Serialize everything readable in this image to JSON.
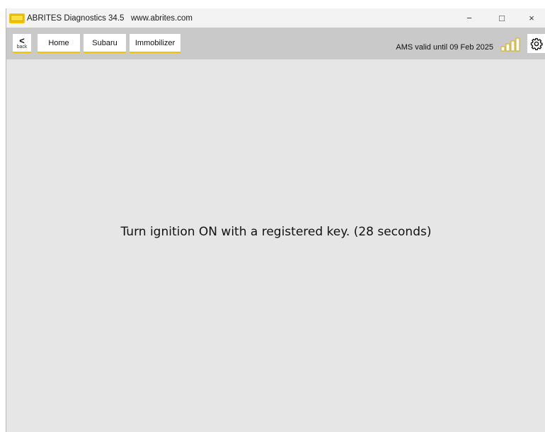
{
  "window": {
    "title": "ABRITES Diagnostics 34.5   www.abrites.com",
    "controls": {
      "minimize": "−",
      "maximize": "□",
      "close": "×"
    }
  },
  "toolbar": {
    "back_label": "back",
    "back_glyph": "<",
    "breadcrumbs": [
      "Home",
      "Subaru",
      "Immobilizer"
    ],
    "ams_status": "AMS valid until 09 Feb 2025",
    "signal_icon": "signal-bars-icon",
    "settings_icon": "gear-icon"
  },
  "main": {
    "message": "Turn ignition ON with a registered key. (28 seconds)"
  },
  "colors": {
    "accent": "#f4c400",
    "toolbar_bg": "#c9c9c9",
    "content_bg": "#e6e6e6"
  }
}
